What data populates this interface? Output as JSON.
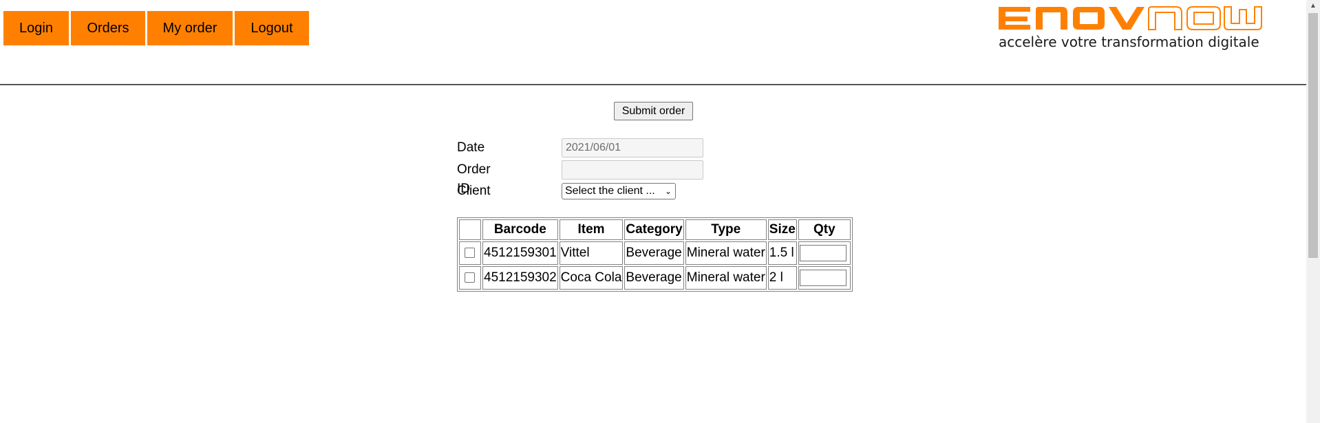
{
  "nav": {
    "login": "Login",
    "orders": "Orders",
    "my_order": "My order",
    "logout": "Logout"
  },
  "logo": {
    "word_left": "ENOV",
    "word_right": "NOW",
    "tagline": "accelère votre transformation digitale",
    "color": "#ff8000"
  },
  "submit_label": "Submit order",
  "form": {
    "date_label": "Date",
    "date_value": "2021/06/01",
    "order_id_label": "Order ID",
    "order_id_value": "",
    "client_label": "Client",
    "client_selected": "Select the client ..."
  },
  "table": {
    "headers": [
      "",
      "Barcode",
      "Item",
      "Category",
      "Type",
      "Size",
      "Qty"
    ],
    "rows": [
      {
        "barcode": "4512159301",
        "item": "Vittel",
        "category": "Beverage",
        "type": "Mineral water",
        "size": "1.5 l",
        "qty": ""
      },
      {
        "barcode": "4512159302",
        "item": "Coca Cola",
        "category": "Beverage",
        "type": "Mineral water",
        "size": "2 l",
        "qty": ""
      }
    ]
  },
  "colors": {
    "accent": "#ff8000",
    "divider": "#555555"
  }
}
